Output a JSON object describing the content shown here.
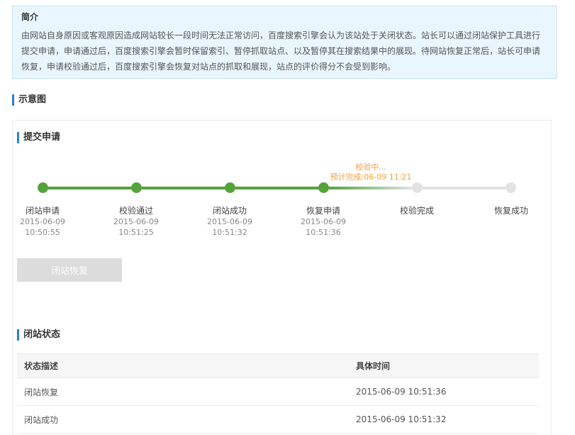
{
  "intro": {
    "title": "简介",
    "body": "由网站自身原因或客观原因造成网站较长一段时间无法正常访问，百度搜索引擎会认为该站处于关闭状态。站长可以通过闭站保护工具进行提交申请，申请通过后，百度搜索引擎会暂时保留索引、暂停抓取站点、以及暂停其在搜索结果中的展现。待网站恢复正常后，站长可申请恢复，申请校验通过后，百度搜索引擎会恢复对站点的抓取和展现，站点的评价得分不会受到影响。"
  },
  "diagram_heading": "示意图",
  "submit_heading": "提交申请",
  "timeline": {
    "steps": [
      {
        "label": "闭站申请",
        "date": "2015-06-09",
        "time": "10:50:55",
        "state": "done"
      },
      {
        "label": "校验通过",
        "date": "2015-06-09",
        "time": "10:51:25",
        "state": "done"
      },
      {
        "label": "闭站成功",
        "date": "2015-06-09",
        "time": "10:51:32",
        "state": "done"
      },
      {
        "label": "恢复申请",
        "date": "2015-06-09",
        "time": "10:51:36",
        "state": "done"
      },
      {
        "label": "校验完成",
        "date": "",
        "time": "",
        "state": "todo"
      },
      {
        "label": "恢复成功",
        "date": "",
        "time": "",
        "state": "todo"
      }
    ],
    "progress_note_1": "校验中...",
    "progress_note_2": "预计完成:06-09 11:21",
    "colors": {
      "done": "#55a33b",
      "todo": "#e2e2e2",
      "note": "#f0a040"
    }
  },
  "restore_button": "闭站恢复",
  "status": {
    "heading": "闭站状态",
    "col_desc": "状态描述",
    "col_time": "具体时间",
    "rows": [
      {
        "desc": "闭站恢复",
        "time": "2015-06-09 10:51:36"
      },
      {
        "desc": "闭站成功",
        "time": "2015-06-09 10:51:32"
      }
    ]
  }
}
